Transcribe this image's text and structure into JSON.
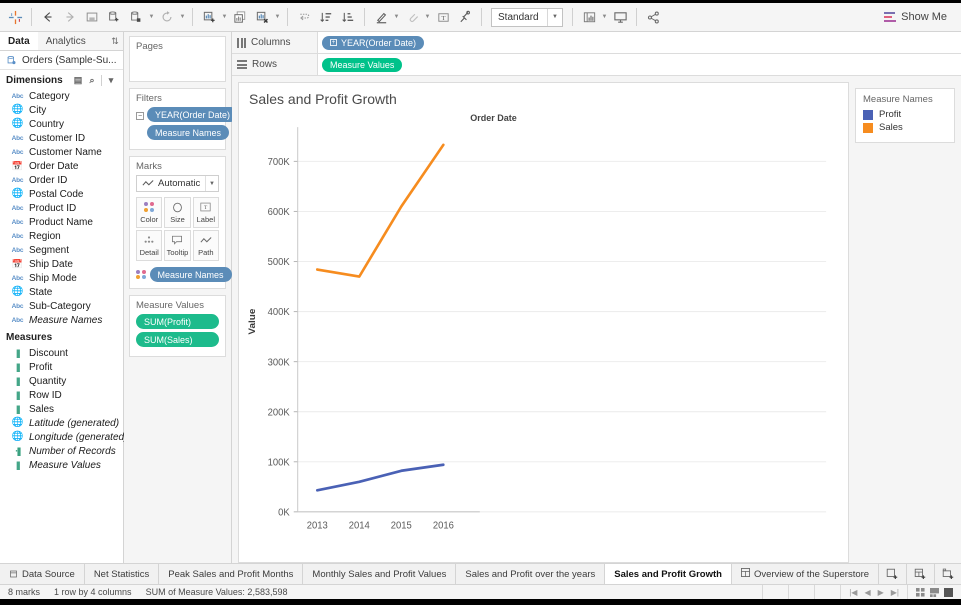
{
  "toolbar": {
    "icons": [
      {
        "name": "tableau-logo-icon",
        "glyph": "✻"
      },
      {
        "name": "back-icon",
        "glyph": "←"
      },
      {
        "name": "forward-icon",
        "glyph": "→"
      },
      {
        "name": "save-icon",
        "glyph": "▣"
      },
      {
        "name": "new-data-source-icon",
        "glyph": "⊞"
      },
      {
        "name": "new-worksheet-icon",
        "glyph": "▤"
      },
      {
        "name": "refresh-data-icon",
        "glyph": "↻"
      },
      {
        "name": "duplicate-sheet-icon",
        "glyph": "▦"
      },
      {
        "name": "clear-sheet-icon",
        "glyph": "▧"
      },
      {
        "name": "clear-all-icon",
        "glyph": "▨"
      },
      {
        "name": "swap-rows-columns-icon",
        "glyph": "⇄"
      },
      {
        "name": "sort-ascending-icon",
        "glyph": "↓A"
      },
      {
        "name": "sort-descending-icon",
        "glyph": "↓Z"
      },
      {
        "name": "highlight-icon",
        "glyph": "✎"
      },
      {
        "name": "group-members-icon",
        "glyph": "🖇"
      },
      {
        "name": "show-mark-labels-icon",
        "glyph": "T"
      },
      {
        "name": "fix-axes-icon",
        "glyph": "⚲"
      },
      {
        "name": "presentation-icon",
        "glyph": "🖵"
      },
      {
        "name": "share-icon",
        "glyph": "≼"
      }
    ],
    "fit_value": "Standard",
    "show_me_label": "Show Me"
  },
  "data_pane": {
    "tabs": [
      {
        "label": "Data",
        "active": true
      },
      {
        "label": "Analytics",
        "active": false
      }
    ],
    "sort_icon": "⇅",
    "data_source": {
      "label": "Orders (Sample-Su...",
      "icon": "database-icon"
    },
    "dimensions": {
      "title": "Dimensions",
      "fields": [
        {
          "label": "Category",
          "type": "abc"
        },
        {
          "label": "City",
          "type": "geo"
        },
        {
          "label": "Country",
          "type": "geo"
        },
        {
          "label": "Customer ID",
          "type": "abc"
        },
        {
          "label": "Customer Name",
          "type": "abc"
        },
        {
          "label": "Order Date",
          "type": "date"
        },
        {
          "label": "Order ID",
          "type": "abc"
        },
        {
          "label": "Postal Code",
          "type": "geo"
        },
        {
          "label": "Product ID",
          "type": "abc"
        },
        {
          "label": "Product Name",
          "type": "abc"
        },
        {
          "label": "Region",
          "type": "abc"
        },
        {
          "label": "Segment",
          "type": "abc"
        },
        {
          "label": "Ship Date",
          "type": "date"
        },
        {
          "label": "Ship Mode",
          "type": "abc"
        },
        {
          "label": "State",
          "type": "geo"
        },
        {
          "label": "Sub-Category",
          "type": "abc"
        },
        {
          "label": "Measure Names",
          "type": "abc",
          "italic": true
        }
      ]
    },
    "measures": {
      "title": "Measures",
      "fields": [
        {
          "label": "Discount",
          "type": "num"
        },
        {
          "label": "Profit",
          "type": "num"
        },
        {
          "label": "Quantity",
          "type": "num"
        },
        {
          "label": "Row ID",
          "type": "num"
        },
        {
          "label": "Sales",
          "type": "num"
        },
        {
          "label": "Latitude (generated)",
          "type": "geo-green",
          "italic": true
        },
        {
          "label": "Longitude (generated)",
          "type": "geo-green",
          "italic": true
        },
        {
          "label": "Number of Records",
          "type": "num-small",
          "italic": true
        },
        {
          "label": "Measure Values",
          "type": "num",
          "italic": true
        }
      ]
    }
  },
  "shelves": {
    "pages": {
      "title": "Pages",
      "pills": []
    },
    "filters": {
      "title": "Filters",
      "pills": [
        {
          "label": "YEAR(Order Date)",
          "color": "blue",
          "has_checkbox": true
        },
        {
          "label": "Measure Names",
          "color": "blue",
          "has_checkbox": false
        }
      ]
    },
    "marks": {
      "title": "Marks",
      "mark_type": "Automatic",
      "buttons": [
        {
          "label": "Color",
          "icon": "color-dots-icon"
        },
        {
          "label": "Size",
          "icon": "size-circle-icon"
        },
        {
          "label": "Label",
          "icon": "label-text-icon"
        },
        {
          "label": "Detail",
          "icon": "detail-dots-icon"
        },
        {
          "label": "Tooltip",
          "icon": "tooltip-bubble-icon"
        },
        {
          "label": "Path",
          "icon": "path-line-icon"
        }
      ],
      "encoding_pill": {
        "label": "Measure Names",
        "color": "blue"
      }
    },
    "measure_values": {
      "title": "Measure Values",
      "pills": [
        {
          "label": "SUM(Profit)",
          "color": "green"
        },
        {
          "label": "SUM(Sales)",
          "color": "green"
        }
      ]
    },
    "columns": {
      "label": "Columns",
      "pills": [
        {
          "label": "YEAR(Order Date)",
          "color": "blue",
          "expand": "⊞"
        }
      ]
    },
    "rows": {
      "label": "Rows",
      "pills": [
        {
          "label": "Measure Values",
          "color": "green2"
        }
      ]
    }
  },
  "worksheet": {
    "title": "Sales and Profit Growth",
    "column_header": "Order Date"
  },
  "legend": {
    "title": "Measure Names",
    "items": [
      {
        "label": "Profit",
        "color": "#4a61b5"
      },
      {
        "label": "Sales",
        "color": "#f68c1f"
      }
    ]
  },
  "sheet_tabs": {
    "data_source_label": "Data Source",
    "tabs": [
      {
        "label": "Net Statistics",
        "active": false
      },
      {
        "label": "Peak Sales and Profit Months",
        "active": false
      },
      {
        "label": "Monthly Sales and Profit Values",
        "active": false
      },
      {
        "label": "Sales and Profit over the years",
        "active": false
      },
      {
        "label": "Sales and Profit Growth",
        "active": true
      },
      {
        "label": "Overview of the Superstore",
        "active": false,
        "icon": "dashboard-icon"
      }
    ],
    "new_buttons": [
      {
        "name": "new-worksheet-tab-button",
        "glyph": "▱"
      },
      {
        "name": "new-dashboard-tab-button",
        "glyph": "▤"
      },
      {
        "name": "new-story-tab-button",
        "glyph": "▥"
      }
    ]
  },
  "status": {
    "marks": "8 marks",
    "rows_cols": "1 row by 4 columns",
    "sum": "SUM of Measure Values: 2,583,598"
  },
  "chart_data": {
    "type": "line",
    "title": "Sales and Profit Growth",
    "xlabel": "Order Date",
    "ylabel": "Value",
    "categories": [
      "2013",
      "2014",
      "2015",
      "2016"
    ],
    "x": [
      2013,
      2014,
      2015,
      2016
    ],
    "series": [
      {
        "name": "Profit",
        "color": "#4a61b5",
        "values": [
          43000,
          60000,
          82000,
          94000
        ]
      },
      {
        "name": "Sales",
        "color": "#f68c1f",
        "values": [
          484000,
          470000,
          610000,
          733000
        ]
      }
    ],
    "ylim": [
      0,
      760000
    ],
    "yticks": [
      0,
      100000,
      200000,
      300000,
      400000,
      500000,
      600000,
      700000
    ],
    "ytick_labels": [
      "0K",
      "100K",
      "200K",
      "300K",
      "400K",
      "500K",
      "600K",
      "700K"
    ],
    "grid": true,
    "legend_position": "right"
  }
}
